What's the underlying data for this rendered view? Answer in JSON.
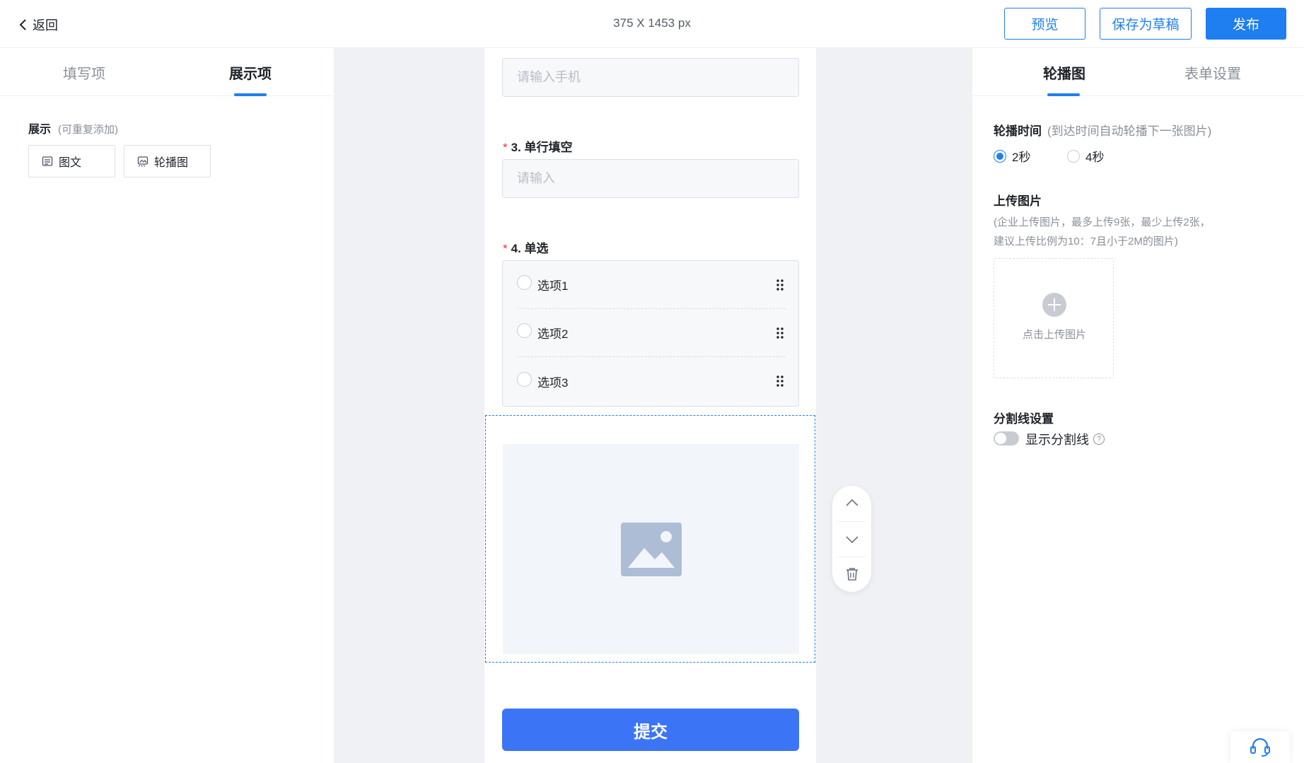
{
  "topbar": {
    "back_label": "返回",
    "canvas_size": "375 X 1453 px",
    "preview_label": "预览",
    "save_draft_label": "保存为草稿",
    "publish_label": "发布"
  },
  "left_panel": {
    "tabs": [
      {
        "label": "填写项",
        "active": false
      },
      {
        "label": "展示项",
        "active": true
      }
    ],
    "section_title": "展示",
    "section_hint": "(可重复添加)",
    "components": [
      {
        "label": "图文",
        "icon": "image-text-icon"
      },
      {
        "label": "轮播图",
        "icon": "carousel-icon"
      }
    ]
  },
  "canvas": {
    "phone_placeholder": "请输入手机",
    "q3_number": "3.",
    "q3_title": "单行填空",
    "q3_placeholder": "请输入",
    "q4_number": "4.",
    "q4_title": "单选",
    "q4_options": [
      "选项1",
      "选项2",
      "选项3"
    ],
    "required_mark": "*",
    "submit_label": "提交"
  },
  "right_panel": {
    "tabs": [
      {
        "label": "轮播图",
        "active": true
      },
      {
        "label": "表单设置",
        "active": false
      }
    ],
    "interval_title": "轮播时间",
    "interval_hint": "(到达时间自动轮播下一张图片)",
    "interval_options": [
      {
        "label": "2秒",
        "selected": true
      },
      {
        "label": "4秒",
        "selected": false
      }
    ],
    "upload_title": "上传图片",
    "upload_desc_line1": "(企业上传图片，最多上传9张，最少上传2张，",
    "upload_desc_line2": "建议上传比例为10：7且小于2M的图片)",
    "upload_button_label": "点击上传图片",
    "divider_title": "分割线设置",
    "divider_switch_label": "显示分割线",
    "divider_switch_on": false
  },
  "colors": {
    "accent": "#1f7ef0",
    "submit": "#3c74f6",
    "required": "#e5343a",
    "canvas_bg": "#eff1f5",
    "muted_text": "#8a9099"
  }
}
